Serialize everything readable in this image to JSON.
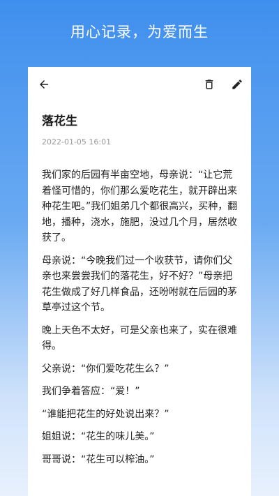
{
  "header": {
    "slogan": "用心记录，为爱而生"
  },
  "toolbar": {
    "back_icon": "arrow-left-icon",
    "delete_icon": "trash-icon",
    "edit_icon": "pencil-icon"
  },
  "note": {
    "title": "落花生",
    "timestamp": "2022-01-05 16:01",
    "paragraphs": [
      "我们家的后园有半亩空地，母亲说：“让它荒着怪可惜的，你们那么爱吃花生，就开辟出来种花生吧。”我们姐弟几个都很高兴，买种，翻地，播种，浇水，施肥，没过几个月，居然收获了。",
      "母亲说：“今晚我们过一个收获节，请你们父亲也来尝尝我们的落花生，好不好？”母亲把花生做成了好几样食品，还吩咐就在后园的茅草亭过这个节。",
      "晚上天色不太好，可是父亲也来了，实在很难得。",
      "父亲说：“你们爱吃花生么？”",
      "我们争着答应：“爱！”",
      "“谁能把花生的好处说出来？”",
      "姐姐说：“花生的味儿美。”",
      "哥哥说：“花生可以榨油。”"
    ]
  }
}
